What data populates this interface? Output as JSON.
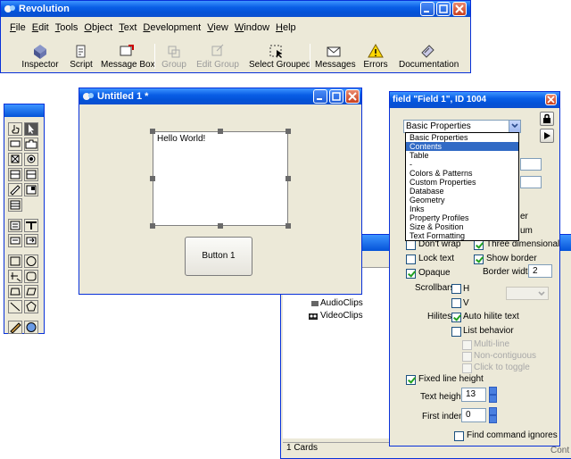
{
  "main_window": {
    "title": "Revolution",
    "menu": [
      "File",
      "Edit",
      "Tools",
      "Object",
      "Text",
      "Development",
      "View",
      "Window",
      "Help"
    ],
    "toolbar": [
      {
        "label": "Inspector",
        "icon": "inspector-icon",
        "enabled": true
      },
      {
        "label": "Script",
        "icon": "script-icon",
        "enabled": true
      },
      {
        "label": "Message Box",
        "icon": "message-box-icon",
        "enabled": true
      },
      {
        "label": "Group",
        "icon": "group-icon",
        "enabled": false
      },
      {
        "label": "Edit Group",
        "icon": "edit-group-icon",
        "enabled": false
      },
      {
        "label": "Select Grouped",
        "icon": "select-grouped-icon",
        "enabled": true
      },
      {
        "label": "Messages",
        "icon": "messages-icon",
        "enabled": true
      },
      {
        "label": "Errors",
        "icon": "errors-icon",
        "enabled": true
      },
      {
        "label": "Documentation",
        "icon": "documentation-icon",
        "enabled": true
      }
    ]
  },
  "stack_window": {
    "title": "Untitled 1 *",
    "field_text": "Hello World!",
    "button_label": "Button 1"
  },
  "browser": {
    "items": [
      "AudioClips",
      "VideoClips"
    ],
    "status": "1 Cards",
    "right_status": "Cont"
  },
  "inspector": {
    "title": "field \"Field 1\", ID 1004",
    "selected_pane": "Basic Properties",
    "pane_options": [
      "Basic Properties",
      "Contents",
      "Table",
      "-",
      "Colors & Patterns",
      "Custom Properties",
      "Database",
      "Geometry",
      "Inks",
      "Property Profiles",
      "Size & Position",
      "Text Formatting"
    ],
    "highlighted_option": "Contents",
    "partial_labels": {
      "er": "er",
      "um": "um"
    },
    "checkboxes": {
      "dont_wrap": {
        "label": "Don't wrap",
        "checked": false
      },
      "three_dimensional": {
        "label": "Three dimensional",
        "checked": true
      },
      "lock_text": {
        "label": "Lock text",
        "checked": false
      },
      "show_border": {
        "label": "Show border",
        "checked": true
      },
      "opaque": {
        "label": "Opaque",
        "checked": true
      },
      "scroll_h": {
        "label": "H",
        "checked": false
      },
      "scroll_v": {
        "label": "V",
        "checked": false
      },
      "auto_hilite": {
        "label": "Auto hilite text",
        "checked": true
      },
      "list_behavior": {
        "label": "List behavior",
        "checked": false
      },
      "multi_line": {
        "label": "Multi-line",
        "checked": false
      },
      "non_contiguous": {
        "label": "Non-contiguous",
        "checked": false
      },
      "click_to_toggle": {
        "label": "Click to toggle",
        "checked": false
      },
      "fixed_line_height": {
        "label": "Fixed line height",
        "checked": true
      },
      "find_ignores": {
        "label": "Find command ignores",
        "checked": false
      }
    },
    "border_width_label": "Border width",
    "border_width": "2",
    "scrollbars_label": "Scrollbars:",
    "hilites_label": "Hilites:",
    "text_height_label": "Text height",
    "text_height": "13",
    "first_indent_label": "First indent",
    "first_indent": "0"
  },
  "colors": {
    "xp_title_blue": "#0453d8",
    "window_face": "#ece9d8",
    "selection_blue": "#316ac5",
    "close_red": "#c9401f"
  }
}
